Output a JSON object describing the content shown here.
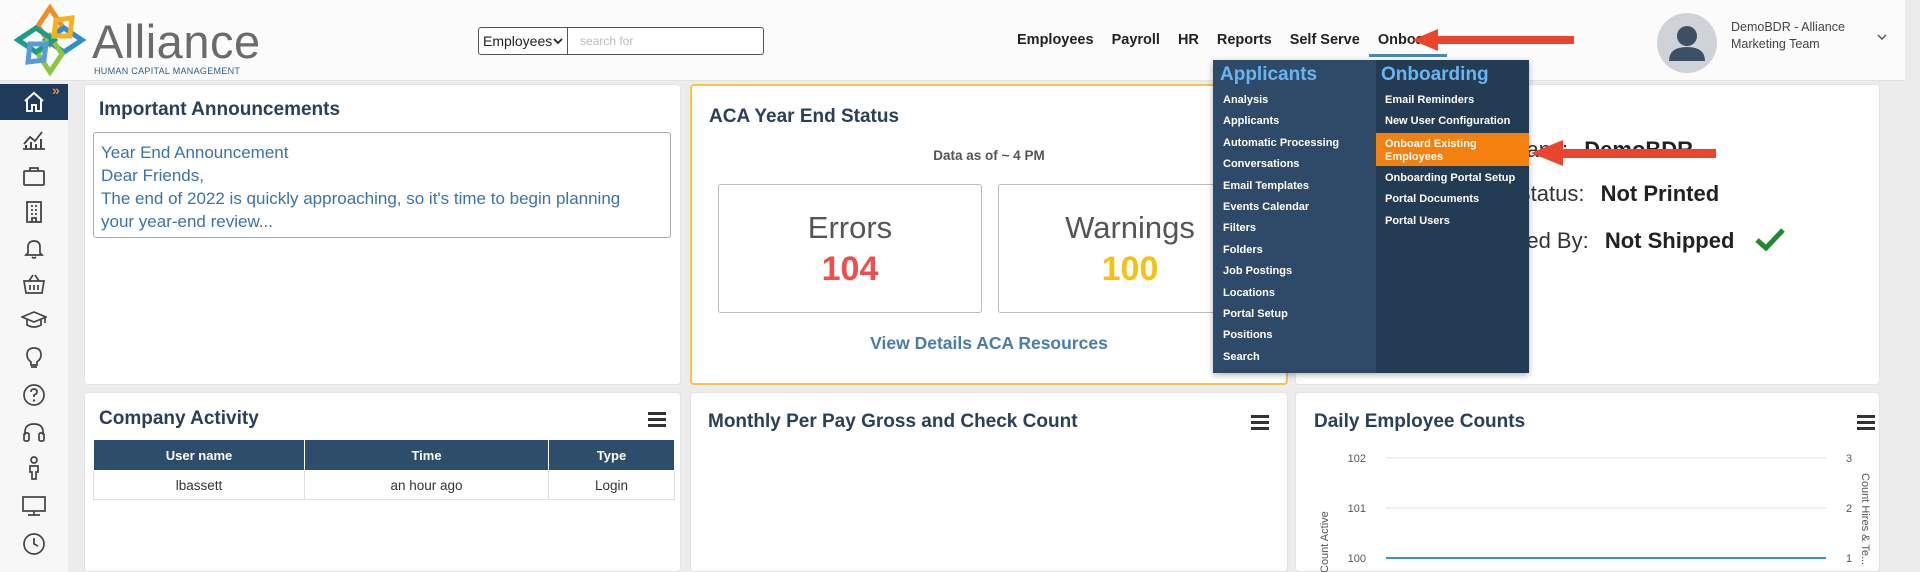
{
  "brand": {
    "name": "Alliance",
    "subtitle": "HUMAN CAPITAL MANAGEMENT",
    "colors": {
      "navy": "#1f3b5b",
      "orange": "#f4800f",
      "light_blue": "#6ab4ef",
      "red_arrow": "#e8452c"
    }
  },
  "search": {
    "scope": "Employees",
    "placeholder": "search for"
  },
  "nav": {
    "items": [
      "Employees",
      "Payroll",
      "HR",
      "Reports",
      "Self Serve",
      "Onboard"
    ],
    "active": "Onboard"
  },
  "user": {
    "line1": "DemoBDR - Alliance",
    "line2": "Marketing Team"
  },
  "sidebar": {
    "icons": [
      "home-icon",
      "analytics-icon",
      "briefcase-icon",
      "building-icon",
      "bell-icon",
      "basket-icon",
      "graduation-cap-icon",
      "lightbulb-icon",
      "question-icon",
      "headset-icon",
      "person-icon",
      "monitor-icon",
      "clock-icon"
    ],
    "expand_glyph": "»"
  },
  "announcements": {
    "title": "Important Announcements",
    "lines": [
      "Year End Announcement",
      "Dear Friends,",
      "The end of 2022 is quickly approaching, so it's time to begin planning",
      "your year-end review..."
    ]
  },
  "aca": {
    "title": "ACA Year End Status",
    "as_of": "Data as of ~ 4 PM",
    "errors_label": "Errors",
    "errors_value": "104",
    "warnings_label": "Warnings",
    "warnings_value": "100",
    "link": "View Details ACA Resources"
  },
  "company_status": {
    "line1_label": "...pany:",
    "line1_value": "DemoBDR",
    "line2_label": "Status:",
    "line2_value": "Not Printed",
    "line3_label": "...ed By:",
    "line3_value": "Not Shipped"
  },
  "activity": {
    "title": "Company Activity",
    "columns": [
      "User name",
      "Time",
      "Type"
    ],
    "rows": [
      [
        "lbassett",
        "an hour ago",
        "Login"
      ]
    ]
  },
  "monthly": {
    "title": "Monthly Per Pay Gross and Check Count"
  },
  "daily": {
    "title": "Daily Employee Counts",
    "chart_data": {
      "type": "line",
      "ylabel": "Count Active",
      "y2label": "Count Hires & Te...",
      "yticks": [
        100,
        101,
        102
      ],
      "y2ticks": [
        1,
        2,
        3
      ],
      "series": [
        {
          "name": "Count Active",
          "values": [
            100,
            100
          ]
        }
      ],
      "grid": true
    }
  },
  "menu": {
    "applicants_head": "Applicants",
    "applicants_items": [
      "Analysis",
      "Applicants",
      "Automatic Processing",
      "Conversations",
      "Email Templates",
      "Events Calendar",
      "Filters",
      "Folders",
      "Job Postings",
      "Locations",
      "Portal Setup",
      "Positions",
      "Search"
    ],
    "onboarding_head": "Onboarding",
    "onboarding_items": [
      "Email Reminders",
      "New User Configuration",
      "Onboard Existing Employees",
      "Onboarding Portal Setup",
      "Portal Documents",
      "Portal Users"
    ],
    "highlighted": "Onboard Existing Employees"
  }
}
